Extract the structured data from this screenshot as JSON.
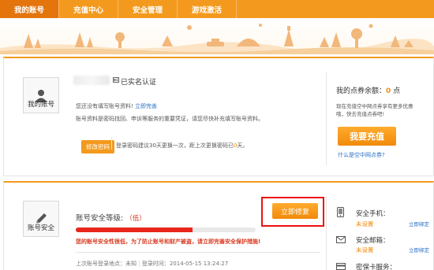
{
  "nav": {
    "tabs": [
      {
        "label": "我的账号",
        "active": true
      },
      {
        "label": "充值中心",
        "active": false
      },
      {
        "label": "安全管理",
        "active": false
      },
      {
        "label": "游戏激活",
        "active": false
      }
    ]
  },
  "account": {
    "icon_label": "我的账号",
    "verified": "已实名认证",
    "hint1_text": "您还没有填写账号资料!",
    "hint1_link": "立即完善",
    "hint2": "账号资料是密码找回、申诉等服务的重要凭证，请您尽快补充填写账号资料。",
    "change_password_btn": "修改密码",
    "password_note_a": "登录密码建议30天更换一次，距上次更换密码已",
    "password_note_days": "0",
    "password_note_b": "天。"
  },
  "points": {
    "label": "我的点券余额：",
    "value": "0",
    "unit": "点",
    "desc": "现在充值空中网点券享有更多优惠哦，快去充值点券吧!",
    "recharge_btn": "我要充值",
    "what_link": "什么是空中网点券?"
  },
  "security": {
    "icon_label": "账号安全",
    "level_label": "账号安全等级:",
    "level_value": "（低）",
    "level_fraction": 0.65,
    "fix_btn": "立即修复",
    "warning": "您的账号安全性很低，为了防止账号和财产被盗，请立即完善安全保护措施!",
    "last_login_label": "上次账号登录地点：未知",
    "login_time": "登录时间：2014-05-15 13:24:27"
  },
  "bind": {
    "phone_label": "安全手机：",
    "phone_status": "未设置",
    "phone_link": "立即绑定",
    "email_label": "安全邮箱：",
    "email_status": "未设置",
    "email_link": "立即绑定",
    "card_label": "密保卡服务："
  },
  "colors": {
    "accent": "#f39a1e",
    "active_tab": "#e4740c",
    "warning_red": "#d93a20",
    "link_blue": "#2a6fc4",
    "highlight_box": "#e11111"
  }
}
